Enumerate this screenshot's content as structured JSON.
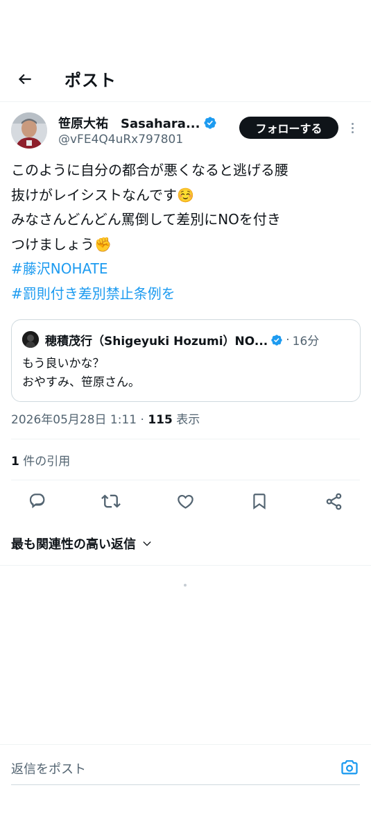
{
  "header": {
    "title": "ポスト"
  },
  "author": {
    "display_name": "笹原大祐　Sasahara...",
    "handle": "@vFE4Q4uRx797801",
    "follow_label": "フォローする"
  },
  "post": {
    "lines": [
      "このように自分の都合が悪くなると逃げる腰",
      "抜けがレイシストなんです☺️",
      "みなさんどんどん罵倒して差別にNOを付き",
      "つけましょう✊"
    ],
    "hashtags": [
      "#藤沢NOHATE",
      "#罰則付き差別禁止条例を"
    ]
  },
  "quoted": {
    "name": "穂積茂行（Shigeyuki Hozumi）NO...",
    "time": "16分",
    "separator": "·",
    "lines": [
      "もう良いかな？",
      "おやすみ、笹原さん。"
    ]
  },
  "meta": {
    "timestamp": "2026年05月28日 1:11",
    "separator": "·",
    "views": "115",
    "views_label": "表示"
  },
  "quotes": {
    "count": "1",
    "label": "件の引用"
  },
  "sort": {
    "label": "最も関連性の高い返信"
  },
  "reply": {
    "placeholder": "返信をポスト"
  },
  "colors": {
    "accent": "#1d9bf0",
    "text": "#0f1419",
    "secondary": "#536471"
  },
  "icons": [
    "back-arrow-icon",
    "verified-badge-icon",
    "more-dots-icon",
    "reply-icon",
    "repost-icon",
    "like-icon",
    "bookmark-icon",
    "share-icon",
    "chevron-down-icon",
    "camera-icon"
  ]
}
